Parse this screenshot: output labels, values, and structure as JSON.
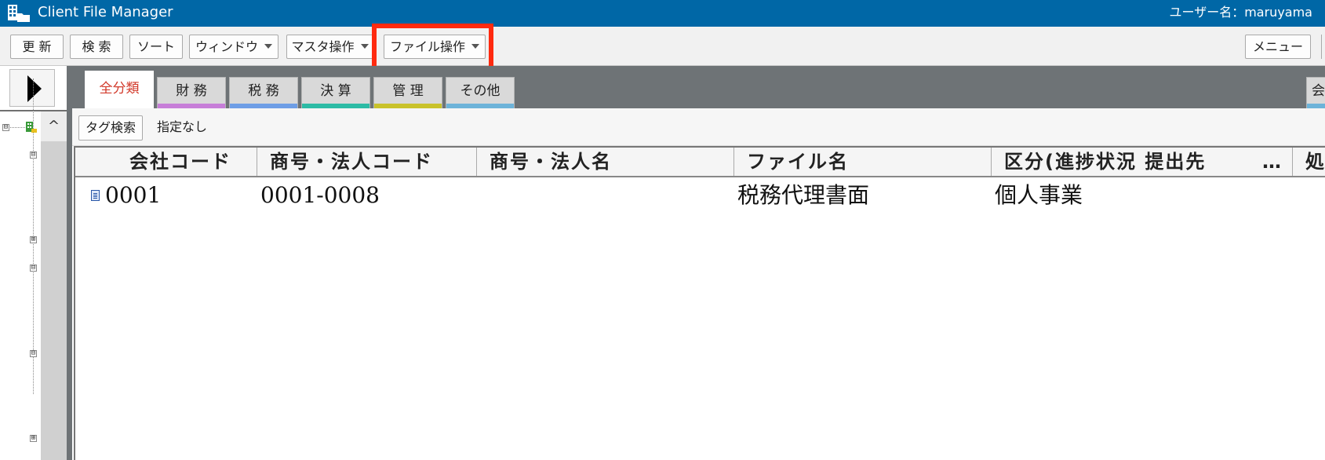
{
  "app": {
    "title": "Client File Manager",
    "user_label": "ユーザー名：maruyama",
    "header_bg": "#0067a6",
    "icon": "building-folder-icon"
  },
  "toolbar": {
    "refresh": "更 新",
    "search": "検 索",
    "sort": "ソート",
    "window": "ウィンドウ",
    "master_ops": "マスタ操作",
    "file_ops": "ファイル操作",
    "menu": "メニュー",
    "highlight_color": "#ff2a0f"
  },
  "tree": {
    "scroll_up": "^",
    "nodes": [
      {
        "symbol": "⊟"
      },
      {
        "symbol": "⊟"
      },
      {
        "symbol": "⊞"
      },
      {
        "symbol": "⊟"
      },
      {
        "symbol": "⊟"
      },
      {
        "symbol": "⊞"
      }
    ]
  },
  "tabs": [
    {
      "label": "全分類",
      "color": "#ffffff",
      "active": true
    },
    {
      "label": "財 務",
      "color": "#c77ed8"
    },
    {
      "label": "税 務",
      "color": "#6e9ee6"
    },
    {
      "label": "決 算",
      "color": "#2dbba5"
    },
    {
      "label": "管 理",
      "color": "#c9c22b"
    },
    {
      "label": "その他",
      "color": "#6db3d9"
    }
  ],
  "tab_right": "会",
  "tag_search": {
    "button": "タグ検索",
    "value": "指定なし"
  },
  "grid": {
    "columns": [
      "会社コード",
      "商号・法人コード",
      "商号・法人名",
      "ファイル名",
      "区分(進捗状況 提出先",
      "処"
    ],
    "more": "…",
    "rows": [
      {
        "company_code": "0001",
        "corp_code": "0001-0008",
        "corp_name": "",
        "file_name": "税務代理書面",
        "category": "個人事業"
      }
    ]
  }
}
